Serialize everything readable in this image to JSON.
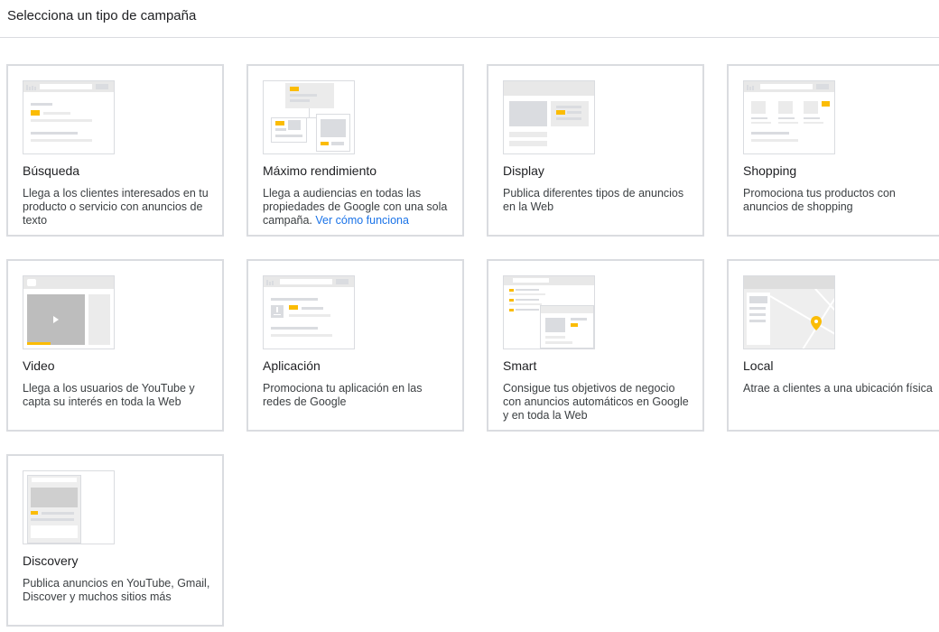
{
  "header": {
    "title": "Selecciona un tipo de campaña"
  },
  "cards": [
    {
      "title": "Búsqueda",
      "desc": "Llega a los clientes interesados en tu producto o servicio con anuncios de texto"
    },
    {
      "title": "Máximo rendimiento",
      "desc": "Llega a audiencias en todas las propiedades de Google con una sola campaña.",
      "link": "Ver cómo funciona"
    },
    {
      "title": "Display",
      "desc": "Publica diferentes tipos de anuncios en la Web"
    },
    {
      "title": "Shopping",
      "desc": "Promociona tus productos con anuncios de shopping"
    },
    {
      "title": "Video",
      "desc": "Llega a los usuarios de YouTube y capta su interés en toda la Web"
    },
    {
      "title": "Aplicación",
      "desc": "Promociona tu aplicación en las redes de Google"
    },
    {
      "title": "Smart",
      "desc": "Consigue tus objetivos de negocio con anuncios automáticos en Google y en toda la Web"
    },
    {
      "title": "Local",
      "desc": "Atrae a clientes a una ubicación física"
    },
    {
      "title": "Discovery",
      "desc": "Publica anuncios en YouTube, Gmail, Discover y muchos sitios más"
    }
  ],
  "colors": {
    "accent": "#fbbc04",
    "link": "#1a73e8",
    "border": "#dadce0"
  }
}
